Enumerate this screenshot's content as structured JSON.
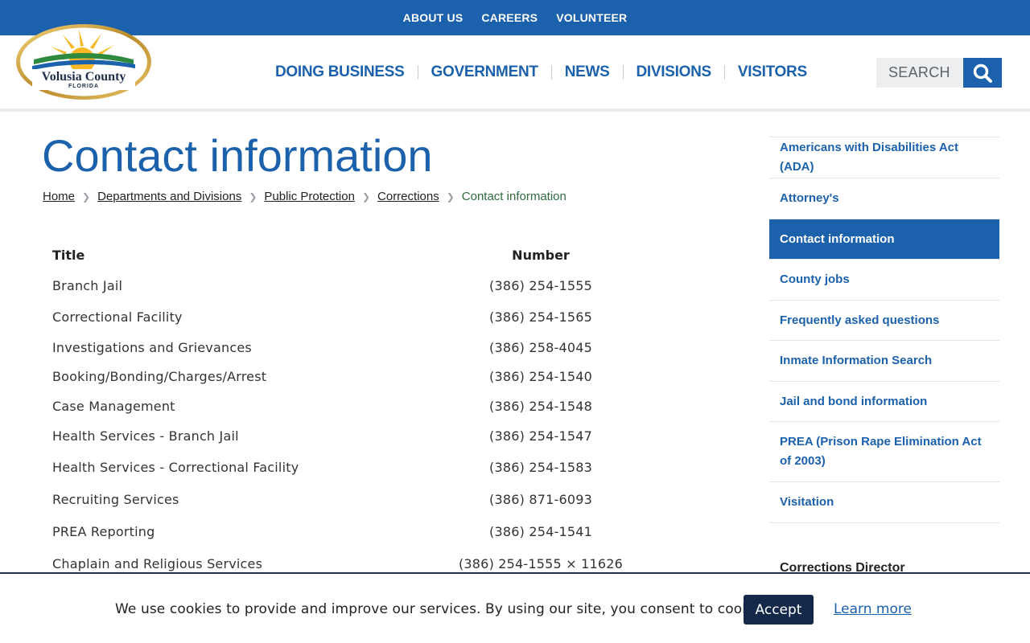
{
  "topbar": {
    "links": [
      "ABOUT US",
      "CAREERS",
      "VOLUNTEER"
    ]
  },
  "logo": {
    "name": "Volusia County",
    "state": "FLORIDA"
  },
  "nav": {
    "items": [
      "DOING BUSINESS",
      "GOVERNMENT",
      "NEWS",
      "DIVISIONS",
      "VISITORS"
    ]
  },
  "search": {
    "label": "SEARCH"
  },
  "page": {
    "title": "Contact information"
  },
  "breadcrumb": {
    "items": [
      "Home",
      "Departments and Divisions",
      "Public Protection",
      "Corrections"
    ],
    "current": "Contact information"
  },
  "table": {
    "headers": [
      "Title",
      "Number"
    ],
    "rows": [
      {
        "title": "Branch Jail",
        "number": "(386) 254-1555"
      },
      {
        "title": "Correctional Facility",
        "number": "(386) 254-1565"
      },
      {
        "title": "Investigations and Grievances",
        "number": "(386) 258-4045"
      },
      {
        "title": "Booking/Bonding/Charges/Arrest",
        "number": "(386) 254-1540"
      },
      {
        "title": "Case Management",
        "number": "(386) 254-1548"
      },
      {
        "title": "Health Services - Branch Jail",
        "number": "(386) 254-1547"
      },
      {
        "title": "Health Services - Correctional Facility",
        "number": "(386) 254-1583"
      },
      {
        "title": "Recruiting Services",
        "number": "(386) 871-6093"
      },
      {
        "title": "PREA Reporting",
        "number": "(386) 254-1541"
      },
      {
        "title": "Chaplain and Religious Services",
        "number": "(386) 254-1555 × 11626"
      }
    ]
  },
  "sidebar": {
    "items": [
      "Americans with Disabilities Act (ADA)",
      "Attorney's",
      "Contact information",
      "County jobs",
      "Frequently asked questions",
      "Inmate Information Search",
      "Jail and bond information",
      "PREA (Prison Rape Elimination Act of 2003)",
      "Visitation"
    ],
    "active": "Contact information",
    "section_heading": "Corrections Director"
  },
  "cookie": {
    "text": "We use cookies to provide and improve our services. By using our site, you consent to cookies.",
    "accept_label": "Accept",
    "learn_more_label": "Learn more"
  },
  "colors": {
    "brand_blue": "#1c61ac",
    "cookie_button": "#14294a",
    "breadcrumb_current": "#2f6a3a"
  }
}
